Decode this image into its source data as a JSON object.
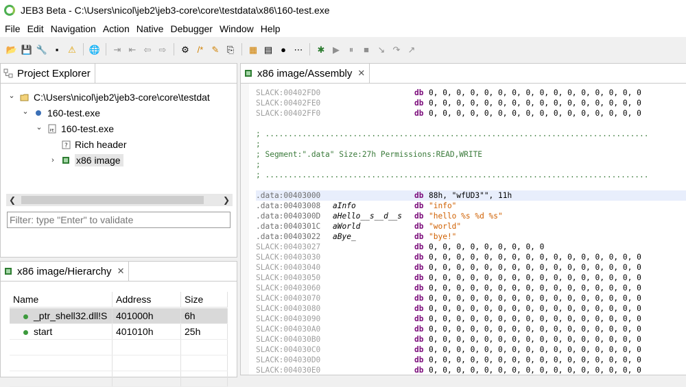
{
  "window": {
    "title": "JEB3 Beta - C:\\Users\\nicol\\jeb2\\jeb3-core\\core\\testdata\\x86\\160-test.exe"
  },
  "menu": [
    "File",
    "Edit",
    "Navigation",
    "Action",
    "Native",
    "Debugger",
    "Window",
    "Help"
  ],
  "toolbar_icons": [
    "open-icon",
    "save-icon",
    "wrench-icon",
    "plugin-icon",
    "warning-icon",
    "globe-icon",
    "import-icon",
    "export-icon",
    "back-icon",
    "forward-icon",
    "decompile-icon",
    "comment-icon",
    "rename-icon",
    "xref-icon",
    "structure-icon",
    "graph-icon",
    "cluster-icon",
    "nodes-icon",
    "debug-icon",
    "run-icon",
    "pause-icon",
    "stop-icon",
    "step-into-icon",
    "step-over-icon",
    "step-out-icon"
  ],
  "project_explorer": {
    "tab": "Project Explorer",
    "tree": [
      {
        "label": "C:\\Users\\nicol\\jeb2\\jeb3-core\\core\\testdat",
        "depth": 0,
        "expanded": true,
        "icon": "folder-icon"
      },
      {
        "label": "160-test.exe",
        "depth": 1,
        "expanded": true,
        "icon": "artifact-icon"
      },
      {
        "label": "160-test.exe",
        "depth": 2,
        "expanded": true,
        "icon": "pe-file-icon"
      },
      {
        "label": "Rich header",
        "depth": 3,
        "expanded": null,
        "icon": "unknown-icon"
      },
      {
        "label": "x86 image",
        "depth": 3,
        "expanded": false,
        "icon": "chip-icon",
        "selected": true
      }
    ],
    "filter_placeholder": "Filter: type \"Enter\" to validate"
  },
  "hierarchy": {
    "tab": "x86 image/Hierarchy",
    "columns": [
      "Name",
      "Address",
      "Size"
    ],
    "rows": [
      {
        "name": "_ptr_shell32.dll!S",
        "address": "401000h",
        "size": "6h",
        "selected": true
      },
      {
        "name": "start",
        "address": "401010h",
        "size": "25h",
        "selected": false
      }
    ]
  },
  "assembly": {
    "tab": "x86 image/Assembly",
    "lines": [
      {
        "kind": "slack",
        "addr": "SLACK:00402FD0",
        "label": "",
        "mn": "db",
        "ops": "0, 0, 0, 0, 0, 0, 0, 0, 0, 0, 0, 0, 0, 0, 0, 0"
      },
      {
        "kind": "slack",
        "addr": "SLACK:00402FE0",
        "label": "",
        "mn": "db",
        "ops": "0, 0, 0, 0, 0, 0, 0, 0, 0, 0, 0, 0, 0, 0, 0, 0"
      },
      {
        "kind": "slack",
        "addr": "SLACK:00402FF0",
        "label": "",
        "mn": "db",
        "ops": "0, 0, 0, 0, 0, 0, 0, 0, 0, 0, 0, 0, 0, 0, 0, 0"
      },
      {
        "kind": "blank"
      },
      {
        "kind": "comment",
        "text": "; ..................................................................................."
      },
      {
        "kind": "comment",
        "text": ";"
      },
      {
        "kind": "comment",
        "text": "; Segment:\".data\" Size:27h Permissions:READ,WRITE"
      },
      {
        "kind": "comment",
        "text": ";"
      },
      {
        "kind": "comment",
        "text": "; ..................................................................................."
      },
      {
        "kind": "blank"
      },
      {
        "kind": "data",
        "addr": ".data:00403000",
        "label": "",
        "mn": "db",
        "ops": "88h, \"wfUD3\"\", 11h",
        "str": false,
        "highlight": true
      },
      {
        "kind": "data",
        "addr": ".data:00403008",
        "label": "aInfo",
        "mn": "db",
        "ops": "\"info\"",
        "str": true
      },
      {
        "kind": "data",
        "addr": ".data:0040300D",
        "label": "aHello__s__d__s",
        "mn": "db",
        "ops": "\"hello %s %d %s\"",
        "str": true
      },
      {
        "kind": "data",
        "addr": ".data:0040301C",
        "label": "aWorld",
        "mn": "db",
        "ops": "\"world\"",
        "str": true
      },
      {
        "kind": "data",
        "addr": ".data:00403022",
        "label": "aBye_",
        "mn": "db",
        "ops": "\"bye!\"",
        "str": true
      },
      {
        "kind": "slack",
        "addr": "SLACK:00403027",
        "label": "",
        "mn": "db",
        "ops": "0, 0, 0, 0, 0, 0, 0, 0, 0"
      },
      {
        "kind": "slack",
        "addr": "SLACK:00403030",
        "label": "",
        "mn": "db",
        "ops": "0, 0, 0, 0, 0, 0, 0, 0, 0, 0, 0, 0, 0, 0, 0, 0"
      },
      {
        "kind": "slack",
        "addr": "SLACK:00403040",
        "label": "",
        "mn": "db",
        "ops": "0, 0, 0, 0, 0, 0, 0, 0, 0, 0, 0, 0, 0, 0, 0, 0"
      },
      {
        "kind": "slack",
        "addr": "SLACK:00403050",
        "label": "",
        "mn": "db",
        "ops": "0, 0, 0, 0, 0, 0, 0, 0, 0, 0, 0, 0, 0, 0, 0, 0"
      },
      {
        "kind": "slack",
        "addr": "SLACK:00403060",
        "label": "",
        "mn": "db",
        "ops": "0, 0, 0, 0, 0, 0, 0, 0, 0, 0, 0, 0, 0, 0, 0, 0"
      },
      {
        "kind": "slack",
        "addr": "SLACK:00403070",
        "label": "",
        "mn": "db",
        "ops": "0, 0, 0, 0, 0, 0, 0, 0, 0, 0, 0, 0, 0, 0, 0, 0"
      },
      {
        "kind": "slack",
        "addr": "SLACK:00403080",
        "label": "",
        "mn": "db",
        "ops": "0, 0, 0, 0, 0, 0, 0, 0, 0, 0, 0, 0, 0, 0, 0, 0"
      },
      {
        "kind": "slack",
        "addr": "SLACK:00403090",
        "label": "",
        "mn": "db",
        "ops": "0, 0, 0, 0, 0, 0, 0, 0, 0, 0, 0, 0, 0, 0, 0, 0"
      },
      {
        "kind": "slack",
        "addr": "SLACK:004030A0",
        "label": "",
        "mn": "db",
        "ops": "0, 0, 0, 0, 0, 0, 0, 0, 0, 0, 0, 0, 0, 0, 0, 0"
      },
      {
        "kind": "slack",
        "addr": "SLACK:004030B0",
        "label": "",
        "mn": "db",
        "ops": "0, 0, 0, 0, 0, 0, 0, 0, 0, 0, 0, 0, 0, 0, 0, 0"
      },
      {
        "kind": "slack",
        "addr": "SLACK:004030C0",
        "label": "",
        "mn": "db",
        "ops": "0, 0, 0, 0, 0, 0, 0, 0, 0, 0, 0, 0, 0, 0, 0, 0"
      },
      {
        "kind": "slack",
        "addr": "SLACK:004030D0",
        "label": "",
        "mn": "db",
        "ops": "0, 0, 0, 0, 0, 0, 0, 0, 0, 0, 0, 0, 0, 0, 0, 0"
      },
      {
        "kind": "slack",
        "addr": "SLACK:004030E0",
        "label": "",
        "mn": "db",
        "ops": "0, 0, 0, 0, 0, 0, 0, 0, 0, 0, 0, 0, 0, 0, 0, 0"
      }
    ]
  }
}
